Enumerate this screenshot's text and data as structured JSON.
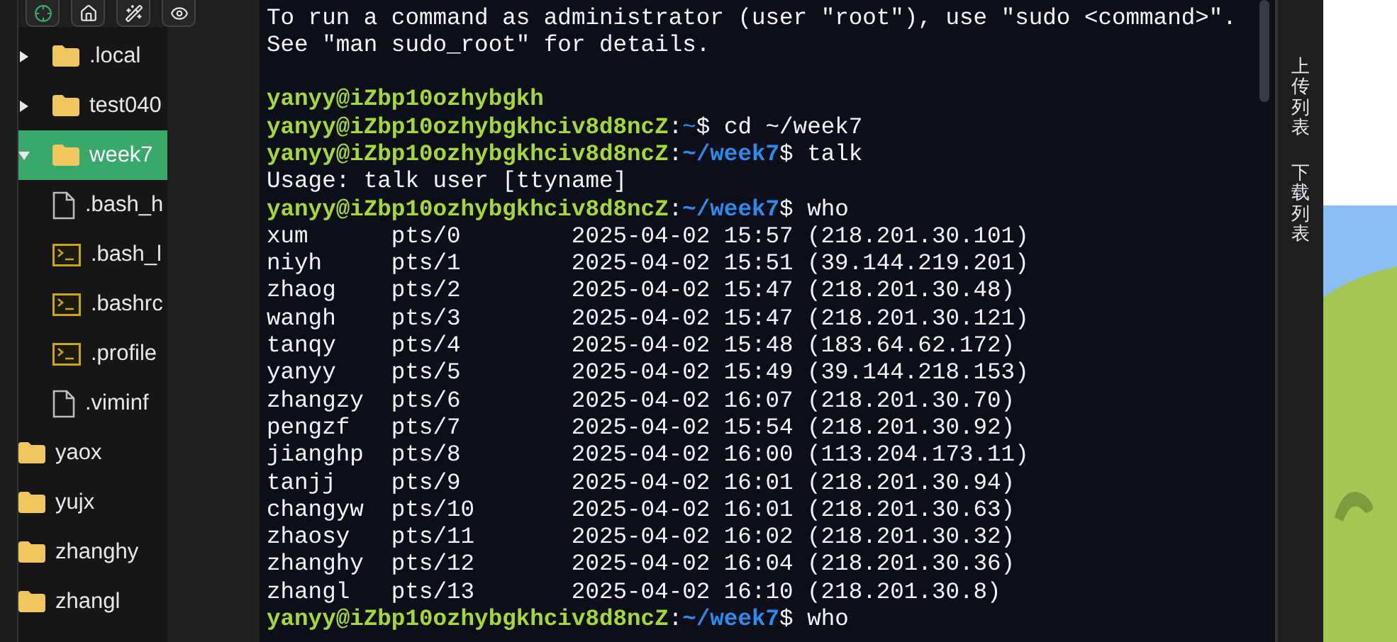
{
  "toolbar": [
    {
      "kind": "target"
    },
    {
      "kind": "home"
    },
    {
      "kind": "wand"
    },
    {
      "kind": "eye"
    }
  ],
  "tree": [
    {
      "children": [
        {
          "name": ".local",
          "kind": "folder",
          "expanded": false,
          "selected": false
        },
        {
          "name": "test040",
          "kind": "folder",
          "expanded": false,
          "selected": false
        },
        {
          "name": "week7",
          "kind": "folder",
          "expanded": true,
          "selected": true,
          "children": [
            {
              "name": ".bash_h",
              "kind": "file",
              "selected": false
            },
            {
              "name": ".bash_l",
              "kind": "script",
              "selected": false
            },
            {
              "name": ".bashrc",
              "kind": "script",
              "selected": false
            },
            {
              "name": ".profile",
              "kind": "script",
              "selected": false
            },
            {
              "name": ".viminf",
              "kind": "file",
              "selected": false
            }
          ]
        }
      ]
    },
    {
      "name": "yaox",
      "kind": "folder",
      "selected": false
    },
    {
      "name": "yujx",
      "kind": "folder",
      "selected": false
    },
    {
      "name": "zhanghy",
      "kind": "folder",
      "selected": false
    },
    {
      "name": "zhangl",
      "kind": "folder",
      "selected": false
    }
  ],
  "terminal": [
    {
      "kind": "text",
      "text": "To run a command as administrator (user \"root\"), use \"sudo <command>\"."
    },
    {
      "kind": "text",
      "text": "See \"man sudo_root\" for details."
    },
    {
      "kind": "blank"
    },
    {
      "kind": "prompt",
      "user_host": "yanyy@iZbp10ozhybgkh"
    },
    {
      "kind": "prompt",
      "user_host": "yanyy@iZbp10ozhybgkhciv8d8ncZ",
      "sep": ":",
      "path": "~",
      "path_bold": false,
      "command": "$ cd ~/week7"
    },
    {
      "kind": "prompt",
      "user_host": "yanyy@iZbp10ozhybgkhciv8d8ncZ",
      "sep": ":",
      "path": "~/week7",
      "path_bold": true,
      "command": "$ talk"
    },
    {
      "kind": "text",
      "text": "Usage: talk user [ttyname]"
    },
    {
      "kind": "prompt",
      "user_host": "yanyy@iZbp10ozhybgkhciv8d8ncZ",
      "sep": ":",
      "path": "~/week7",
      "path_bold": true,
      "command": "$ who"
    },
    {
      "kind": "who",
      "user": "xum",
      "tty": "pts/0",
      "time": "2025-04-02 15:57",
      "from": "(218.201.30.101)"
    },
    {
      "kind": "who",
      "user": "niyh",
      "tty": "pts/1",
      "time": "2025-04-02 15:51",
      "from": "(39.144.219.201)"
    },
    {
      "kind": "who",
      "user": "zhaog",
      "tty": "pts/2",
      "time": "2025-04-02 15:47",
      "from": "(218.201.30.48)"
    },
    {
      "kind": "who",
      "user": "wangh",
      "tty": "pts/3",
      "time": "2025-04-02 15:47",
      "from": "(218.201.30.121)"
    },
    {
      "kind": "who",
      "user": "tanqy",
      "tty": "pts/4",
      "time": "2025-04-02 15:48",
      "from": "(183.64.62.172)"
    },
    {
      "kind": "who",
      "user": "yanyy",
      "tty": "pts/5",
      "time": "2025-04-02 15:49",
      "from": "(39.144.218.153)"
    },
    {
      "kind": "who",
      "user": "zhangzy",
      "tty": "pts/6",
      "time": "2025-04-02 16:07",
      "from": "(218.201.30.70)"
    },
    {
      "kind": "who",
      "user": "pengzf",
      "tty": "pts/7",
      "time": "2025-04-02 15:54",
      "from": "(218.201.30.92)"
    },
    {
      "kind": "who",
      "user": "jianghp",
      "tty": "pts/8",
      "time": "2025-04-02 16:00",
      "from": "(113.204.173.11)"
    },
    {
      "kind": "who",
      "user": "tanjj",
      "tty": "pts/9",
      "time": "2025-04-02 16:01",
      "from": "(218.201.30.94)"
    },
    {
      "kind": "who",
      "user": "changyw",
      "tty": "pts/10",
      "time": "2025-04-02 16:01",
      "from": "(218.201.30.63)"
    },
    {
      "kind": "who",
      "user": "zhaosy",
      "tty": "pts/11",
      "time": "2025-04-02 16:02",
      "from": "(218.201.30.32)"
    },
    {
      "kind": "who",
      "user": "zhanghy",
      "tty": "pts/12",
      "time": "2025-04-02 16:04",
      "from": "(218.201.30.36)"
    },
    {
      "kind": "who",
      "user": "zhangl",
      "tty": "pts/13",
      "time": "2025-04-02 16:10",
      "from": "(218.201.30.8)"
    },
    {
      "kind": "prompt",
      "user_host": "yanyy@iZbp10ozhybgkhciv8d8ncZ",
      "sep": ":",
      "path": "~/week7",
      "path_bold": true,
      "command": "$ who"
    }
  ],
  "side_tabs": [
    {
      "label": "上传列表"
    },
    {
      "label": "下载列表"
    }
  ]
}
